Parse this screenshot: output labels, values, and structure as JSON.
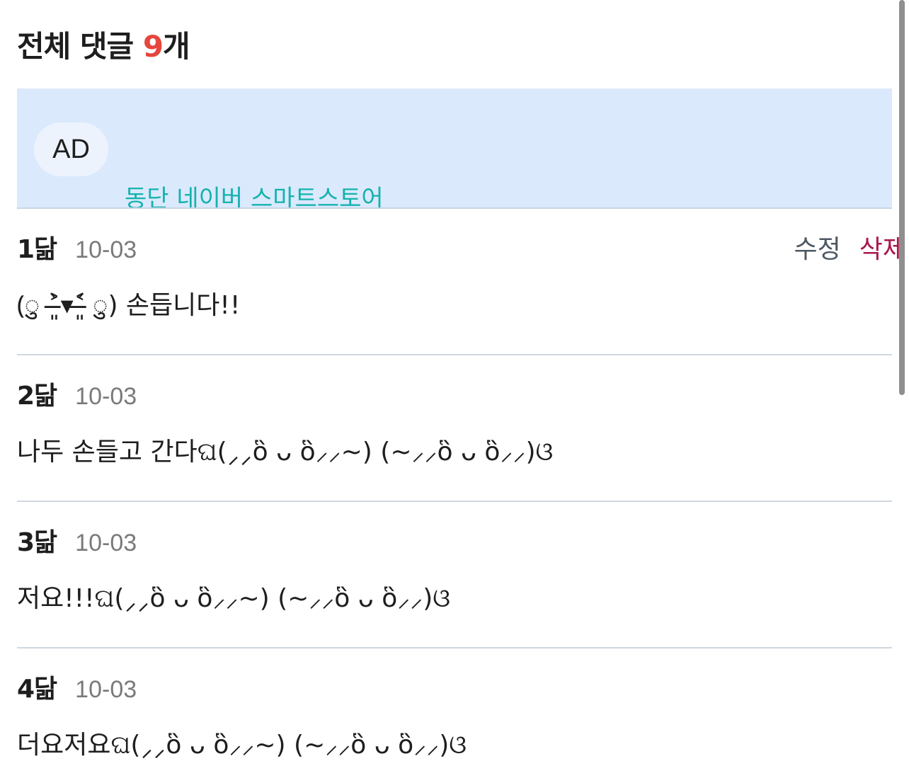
{
  "header": {
    "title_prefix": "전체 댓글 ",
    "count": "9",
    "title_suffix": "개"
  },
  "ad": {
    "badge": "AD",
    "title": "동단 네이버 스마트스토어"
  },
  "comments": [
    {
      "author": "1닮",
      "date": "10-03",
      "text": "(ु ˃̶͈̀▾˂̶͈́ ु) 손듭니다!!",
      "edit_label": "수정",
      "delete_label": "삭제"
    },
    {
      "author": "2닮",
      "date": "10-03",
      "text": "나두 손들고 간다ଘ(⸝⸝ὃ ᴗ ὃ⸝⸝~) (~⸝⸝ὃ ᴗ ὃ⸝⸝)ଓ"
    },
    {
      "author": "3닮",
      "date": "10-03",
      "text": "저요!!!ଘ(⸝⸝ὃ ᴗ ὃ⸝⸝~) (~⸝⸝ὃ ᴗ ὃ⸝⸝)ଓ"
    },
    {
      "author": "4닮",
      "date": "10-03",
      "text": "더요저요ଘ(⸝⸝ὃ ᴗ ὃ⸝⸝~) (~⸝⸝ὃ ᴗ ὃ⸝⸝)ଓ"
    }
  ]
}
